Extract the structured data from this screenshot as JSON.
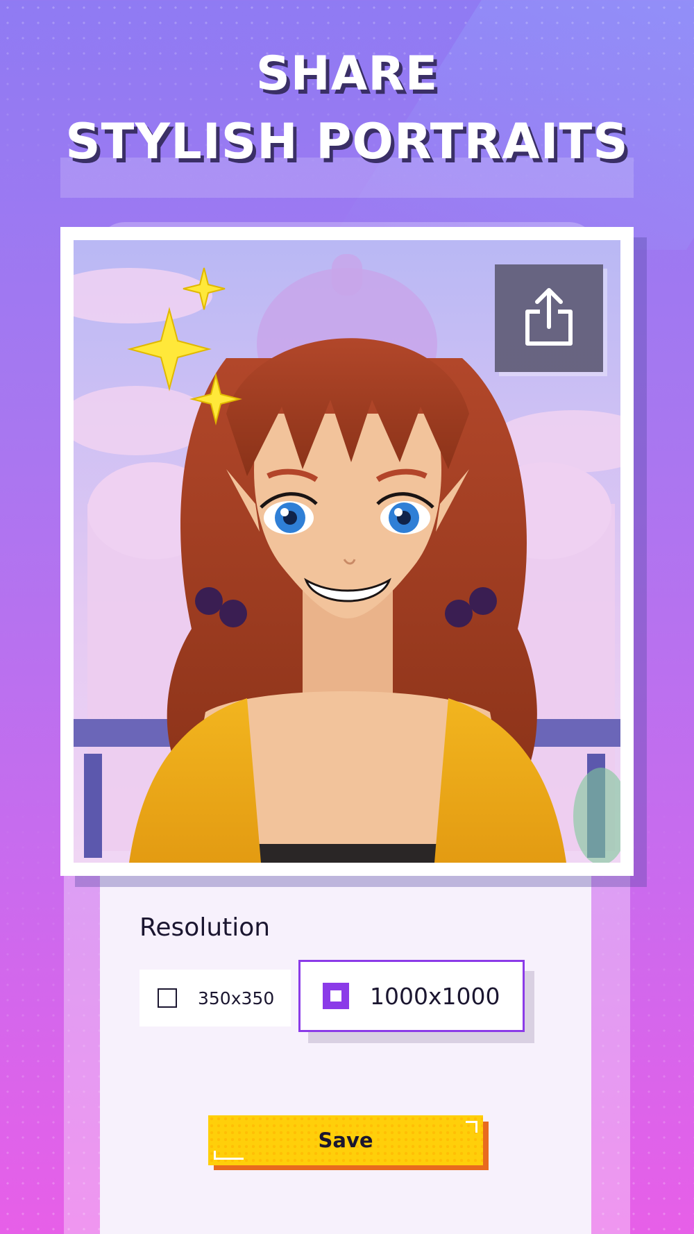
{
  "headline": {
    "line1": "SHARE",
    "line2": "STYLISH PORTRAITS"
  },
  "portrait": {
    "description_icon": "anime-girl-portrait-image",
    "share_icon": "share-upload-icon"
  },
  "resolution": {
    "label": "Resolution",
    "options": [
      {
        "label": "350x350",
        "selected": false
      },
      {
        "label": "1000x1000",
        "selected": true
      }
    ]
  },
  "actions": {
    "save_label": "Save"
  },
  "colors": {
    "accent": "#8b3be8",
    "save_button": "#ffcf0a",
    "save_shadow": "#e86b1e",
    "panel": "#f7f1fc"
  }
}
